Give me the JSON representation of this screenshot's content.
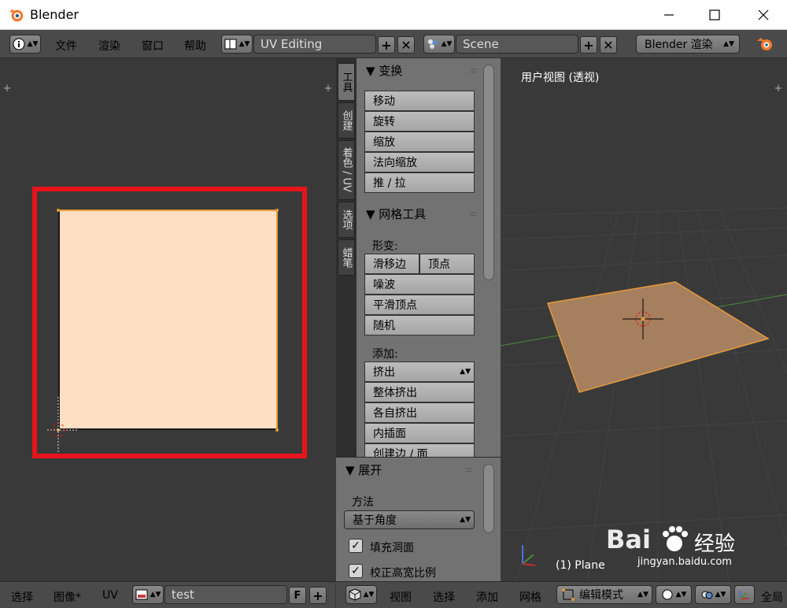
{
  "window": {
    "title": "Blender"
  },
  "infobar": {
    "menus": [
      "文件",
      "渲染",
      "窗口",
      "帮助"
    ],
    "layout": "UV Editing",
    "scene": "Scene",
    "engine": "Blender 渲染"
  },
  "uv_editor": {
    "menus": [
      "选择",
      "图像*",
      "UV"
    ],
    "image_name": "test",
    "fake_user": "F"
  },
  "tool_tabs": [
    "工具",
    "创建",
    "着色 / UV",
    "选项",
    "蜡笔"
  ],
  "transform_panel": {
    "title": "▼ 变换",
    "buttons": [
      "移动",
      "旋转",
      "缩放",
      "法向缩放",
      "推 / 拉"
    ]
  },
  "mesh_tools_panel": {
    "title": "▼ 网格工具",
    "deform_label": "形变:",
    "deform_row": [
      "滑移边",
      "顶点"
    ],
    "deform_buttons": [
      "噪波",
      "平滑顶点",
      "随机"
    ],
    "add_label": "添加:",
    "extrude": "挤出",
    "add_buttons": [
      "整体挤出",
      "各自挤出",
      "内插面",
      "创建边 / 面"
    ]
  },
  "unwrap_panel": {
    "title": "▼ 展开",
    "method_label": "方法",
    "method": "基于角度",
    "fill_holes": "填充洞面",
    "correct_aspect": "校正高宽比例"
  },
  "viewport": {
    "label": "用户视图 (透视)",
    "object": "(1) Plane",
    "menus": [
      "视图",
      "选择",
      "添加",
      "网格"
    ],
    "mode": "编辑模式",
    "global": "全局"
  },
  "watermark": {
    "text": "Bai",
    "text2": "经验",
    "url": "jingyan.baidu.com"
  },
  "colors": {
    "accent": "#e69a3a",
    "highlight": "#e8141b",
    "uv_face": "#ffdfc4"
  }
}
